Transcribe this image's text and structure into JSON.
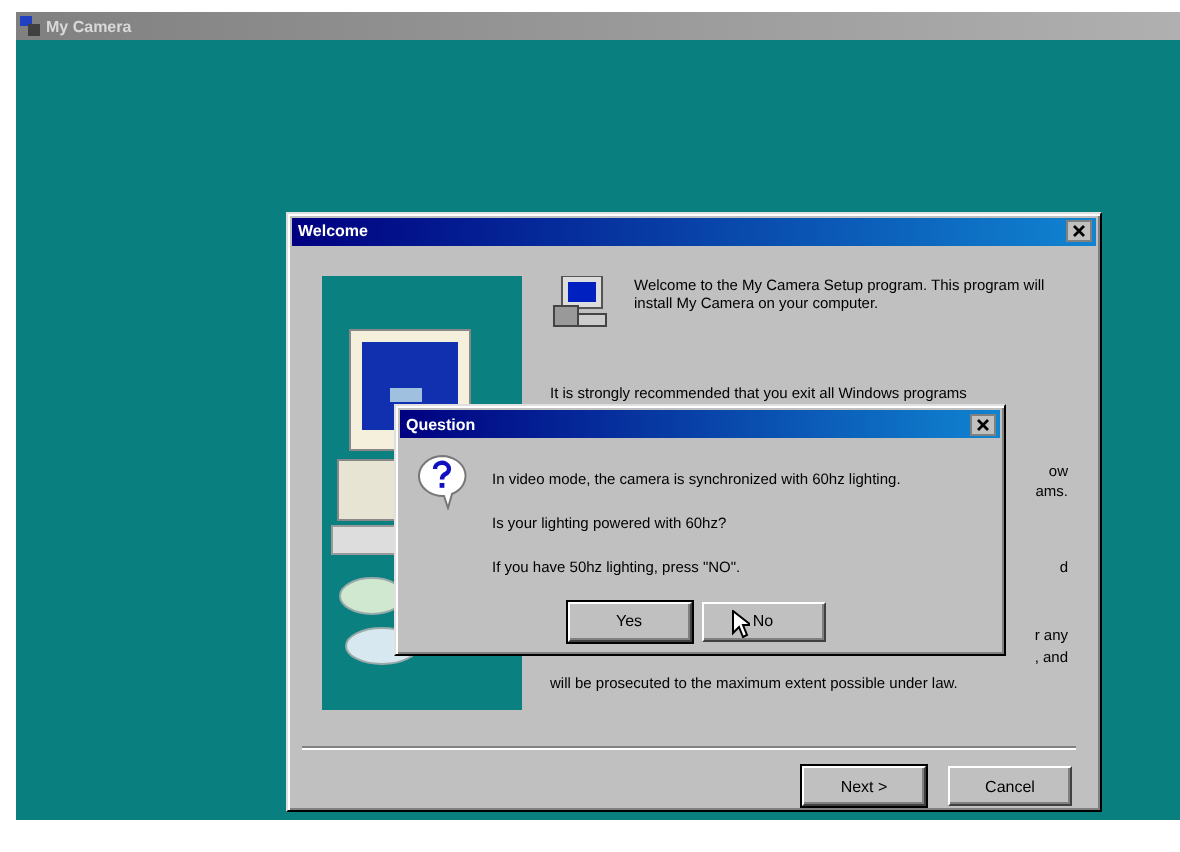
{
  "app_window": {
    "title": "My Camera"
  },
  "welcome_dialog": {
    "title": "Welcome",
    "intro": "Welcome to the My Camera Setup program.  This program will install My Camera on your computer.",
    "fragments": [
      {
        "kind": "line",
        "text": "It is strongly recommended that you exit all Windows programs"
      },
      {
        "kind": "tail",
        "text": "ow"
      },
      {
        "kind": "tail",
        "text": "ams."
      },
      {
        "kind": "tail",
        "text": "d"
      },
      {
        "kind": "tail",
        "text": "r any"
      },
      {
        "kind": "tail",
        "text": ", and"
      },
      {
        "kind": "line",
        "text": "will be prosecuted to the maximum extent possible under law."
      }
    ],
    "buttons": [
      {
        "label": "Next >",
        "default": true
      },
      {
        "label": "Cancel",
        "default": false
      }
    ]
  },
  "question_dialog": {
    "title": "Question",
    "lines": [
      "In video mode, the camera is synchronized with 60hz lighting.",
      "Is your lighting powered with 60hz?",
      "If you have 50hz lighting, press \"NO\"."
    ],
    "buttons": [
      {
        "label": "Yes",
        "default": true
      },
      {
        "label": "No",
        "default": false
      }
    ]
  }
}
